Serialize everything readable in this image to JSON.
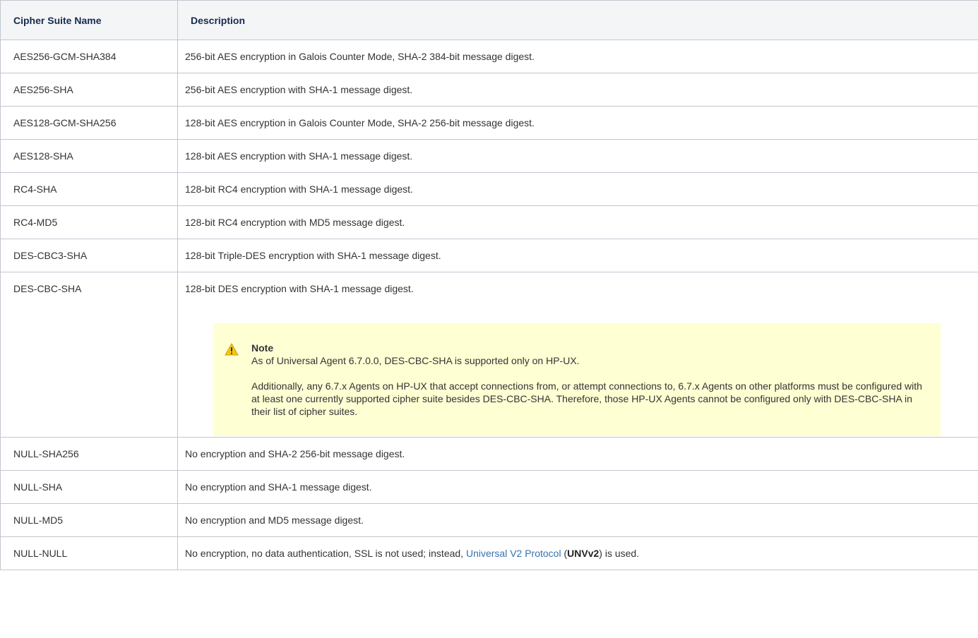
{
  "table": {
    "headers": [
      "Cipher Suite Name",
      "Description"
    ],
    "rows": [
      {
        "name": "AES256-GCM-SHA384",
        "desc": "256-bit AES encryption in Galois Counter Mode, SHA-2 384-bit message digest."
      },
      {
        "name": "AES256-SHA",
        "desc": "256-bit AES encryption with SHA-1 message digest."
      },
      {
        "name": "AES128-GCM-SHA256",
        "desc": "128-bit AES encryption in Galois Counter Mode, SHA-2 256-bit message digest."
      },
      {
        "name": "AES128-SHA",
        "desc": "128-bit AES encryption with SHA-1 message digest."
      },
      {
        "name": "RC4-SHA",
        "desc": "128-bit RC4 encryption with SHA-1 message digest."
      },
      {
        "name": "RC4-MD5",
        "desc": "128-bit RC4 encryption with MD5 message digest."
      },
      {
        "name": "DES-CBC3-SHA",
        "desc": "128-bit Triple-DES encryption with SHA-1 message digest."
      },
      {
        "name": "DES-CBC-SHA",
        "desc": "128-bit DES encryption with SHA-1 message digest."
      },
      {
        "name": "NULL-SHA256",
        "desc": "No encryption and SHA-2 256-bit message digest."
      },
      {
        "name": "NULL-SHA",
        "desc": "No encryption and SHA-1 message digest."
      },
      {
        "name": "NULL-MD5",
        "desc": "No encryption and MD5 message digest."
      },
      {
        "name": "NULL-NULL",
        "desc_pre": "No encryption, no data authentication, SSL is not used; instead, ",
        "desc_link": "Universal V2 Protocol",
        "desc_mid": " (",
        "desc_bold": "UNVv2",
        "desc_post": ") is used."
      }
    ]
  },
  "note": {
    "icon": "warning-icon",
    "title": "Note",
    "para1": "As of Universal Agent 6.7.0.0, DES-CBC-SHA is supported only on HP-UX.",
    "para2": "Additionally, any 6.7.x Agents on HP-UX that accept connections from, or attempt connections to, 6.7.x Agents on other platforms must be configured with at least one currently supported cipher suite besides DES-CBC-SHA. Therefore, those HP-UX Agents cannot be configured only with DES-CBC-SHA in their list of cipher suites."
  },
  "colors": {
    "header_text": "#172b4d",
    "link": "#3572b0",
    "note_bg": "#ffffd4",
    "warning": "#f5c518"
  }
}
